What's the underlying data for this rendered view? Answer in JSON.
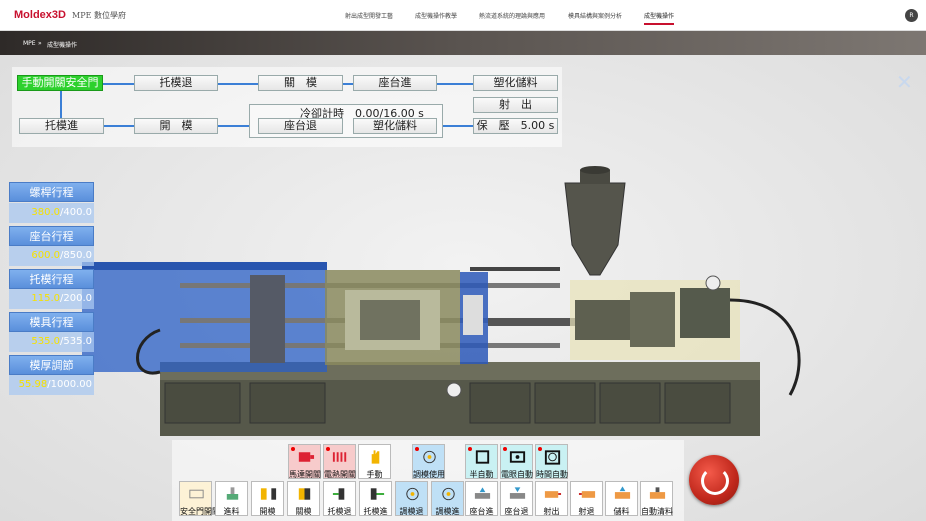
{
  "header": {
    "logo": "Moldex3D",
    "logo_sub": "MPE 數位學府",
    "nav": [
      "射出成型開發工藝",
      "成型機操作教學",
      "熱流道系統的理論與應用",
      "模具結構與案例分析",
      "成型機操作"
    ],
    "active_nav": 4,
    "avatar": "R"
  },
  "breadcrumb": [
    "MPE",
    "»",
    "成型機操作"
  ],
  "flow": {
    "manual_door": "手動開關安全門",
    "eject_back": "托模退",
    "close_mold": "關　模",
    "carriage_fwd": "座台進",
    "plasticize_top": "塑化儲料",
    "inject": "射　出",
    "eject_fwd": "托模進",
    "open_mold": "開　模",
    "carriage_back": "座台退",
    "plasticize_bottom": "塑化儲料",
    "hold_pressure": "保　壓　5.00 s",
    "cooling_timer": "冷卻計時　0.00/16.00 s"
  },
  "strokes": [
    {
      "label": "螺桿行程",
      "current": "380.0",
      "max": "/400.0"
    },
    {
      "label": "座台行程",
      "current": "600.0",
      "max": "/850.0"
    },
    {
      "label": "托模行程",
      "current": "115.0",
      "max": "/200.0"
    },
    {
      "label": "模具行程",
      "current": "535.0",
      "max": "/535.0"
    },
    {
      "label": "模厚調節",
      "current": "55.98",
      "max": "/1000.00"
    }
  ],
  "buttons_top": [
    {
      "label": "馬達開關",
      "icon": "motor-icon"
    },
    {
      "label": "電熱開關",
      "icon": "heater-icon"
    },
    {
      "label": "手動",
      "icon": "hand-icon"
    },
    {
      "label": "調模使用",
      "icon": "mold-adjust-icon"
    },
    {
      "label": "半自動",
      "icon": "semi-auto-icon"
    },
    {
      "label": "電眼自動",
      "icon": "eye-auto-icon"
    },
    {
      "label": "時間自動",
      "icon": "timer-auto-icon"
    }
  ],
  "buttons_bottom": [
    {
      "label": "安全門開關",
      "icon": "safety-door-icon"
    },
    {
      "label": "進料",
      "icon": "feed-icon"
    },
    {
      "label": "開模",
      "icon": "open-mold-icon"
    },
    {
      "label": "關模",
      "icon": "close-mold-icon"
    },
    {
      "label": "托模退",
      "icon": "eject-back-icon"
    },
    {
      "label": "托模進",
      "icon": "eject-fwd-icon"
    },
    {
      "label": "調模退",
      "icon": "adjust-back-icon"
    },
    {
      "label": "調模進",
      "icon": "adjust-fwd-icon"
    },
    {
      "label": "座台進",
      "icon": "carriage-fwd-icon"
    },
    {
      "label": "座台退",
      "icon": "carriage-back-icon"
    },
    {
      "label": "射出",
      "icon": "inject-icon"
    },
    {
      "label": "射退",
      "icon": "suck-back-icon"
    },
    {
      "label": "儲料",
      "icon": "charge-icon"
    },
    {
      "label": "自動清料",
      "icon": "purge-icon"
    }
  ],
  "colors": {
    "accent": "#c8102e",
    "green": "#2dd12d",
    "flow_line": "#3b7fd6"
  }
}
